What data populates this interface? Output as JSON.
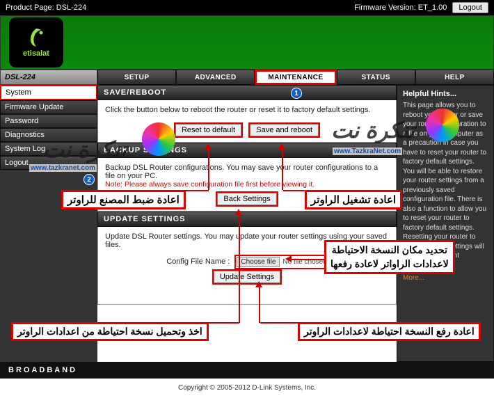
{
  "topbar": {
    "product_label": "Product Page: DSL-224",
    "firmware_label": "Firmware Version: ET_1.00",
    "logout": "Logout"
  },
  "brand": {
    "name": "etisalat"
  },
  "model": "DSL-224",
  "tabs": {
    "setup": "SETUP",
    "advanced": "ADVANCED",
    "maintenance": "MAINTENANCE",
    "status": "STATUS",
    "help": "HELP"
  },
  "side": {
    "system": "System",
    "firmware_update": "Firmware Update",
    "password": "Password",
    "diagnostics": "Diagnostics",
    "system_log": "System Log",
    "logout": "Logout"
  },
  "panels": {
    "save_reboot": {
      "title": "SAVE/REBOOT",
      "desc": "Click the button below to reboot the router or reset it to factory default settings.",
      "reset_btn": "Reset to default",
      "save_btn": "Save and reboot"
    },
    "backup": {
      "title": "BACKUP SETTINGS",
      "desc": "Backup DSL Router configurations. You may save your router configurations to a file on your PC.",
      "note": "Note: Please always save configuration file first before viewing it.",
      "back_btn": "Back Settings"
    },
    "update": {
      "title": "UPDATE SETTINGS",
      "desc": "Update DSL Router settings. You may update your router settings using your saved files.",
      "file_label": "Config File Name :",
      "choose": "Choose file",
      "nofile": "No file chosen",
      "update_btn": "Update Settings"
    }
  },
  "hints": {
    "title": "Helpful Hints...",
    "body": "This page allows you to reboot your router or save your router configuration to a file on your computer as a precaution in case you have to reset your router to factory default settings. You will be able to restore your router settings from a previously saved configuration file. There is also a function to allow you to reset your router to factory default settings. Resetting your router to factory default settings will erase your current configuration.",
    "more": "More..."
  },
  "annotations": {
    "factory_reset": "اعادة ضبط المصنع للراوتر",
    "reboot": "اعادة تشغيل الراوتر",
    "backup_download": "اخذ وتحميل نسخة احتياطة من اعدادات الراوتر",
    "restore_upload": "اعادة رفع النسخة احتياطة لاعدادات الراوتر",
    "choose_location": "تحديد مكان النسخة الاحتياطة\nلاعدادات الراواتر لاعادة رفعها"
  },
  "watermark": {
    "brand": "تنكرة نت",
    "url": "www.TazkraNet.com",
    "small_url": "www.tazkranet.com"
  },
  "broadband": "BROADBAND",
  "copyright": "Copyright © 2005-2012 D-Link Systems, Inc."
}
